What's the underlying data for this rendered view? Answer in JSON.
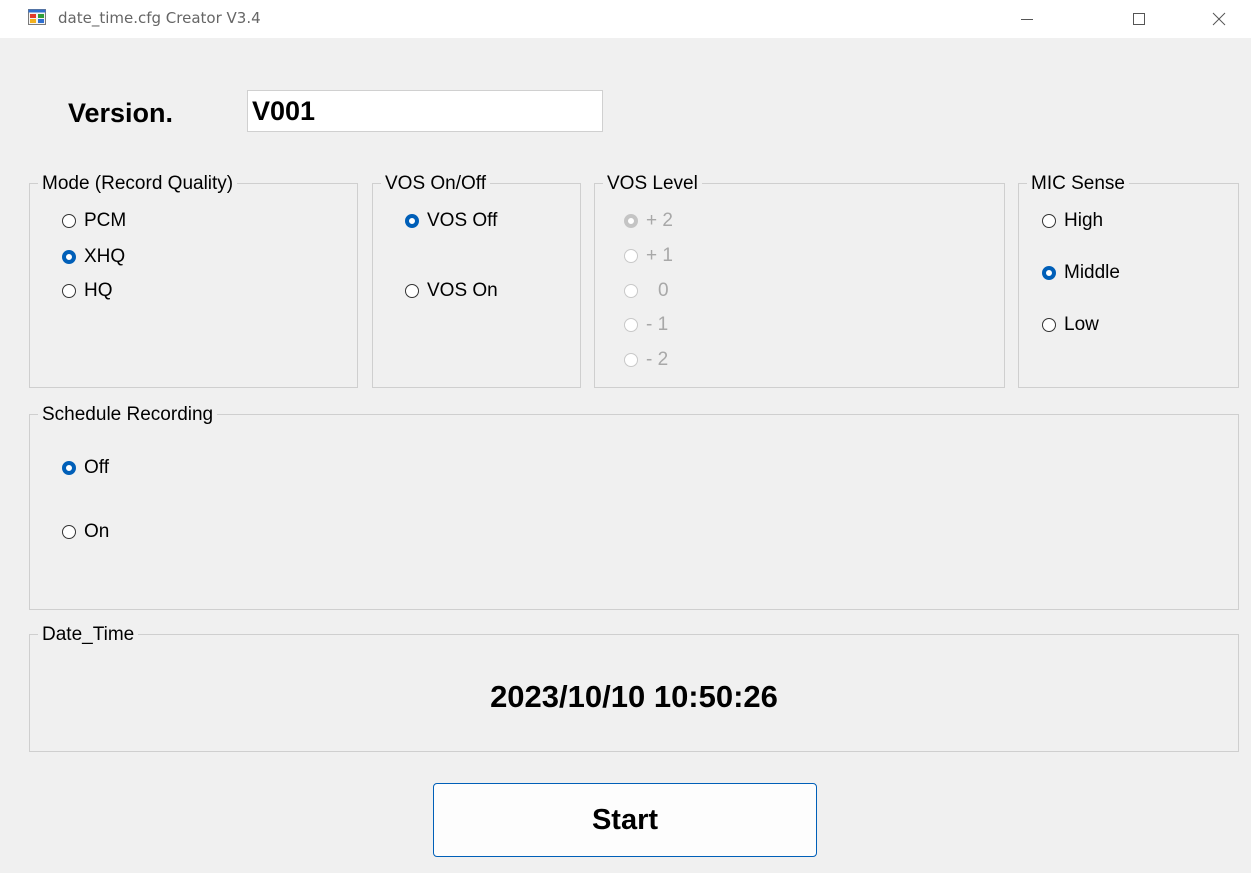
{
  "window": {
    "title": "date_time.cfg Creator V3.4",
    "icons": {
      "app": "form-app-icon",
      "minimize": "minimize-icon",
      "maximize": "maximize-icon",
      "close": "close-icon"
    }
  },
  "version": {
    "label": "Version.",
    "value": "V001"
  },
  "mode_group": {
    "label": "Mode (Record Quality)",
    "options": [
      {
        "label": "PCM",
        "checked": false
      },
      {
        "label": "XHQ",
        "checked": true
      },
      {
        "label": "HQ",
        "checked": false
      }
    ]
  },
  "vos_onoff_group": {
    "label": "VOS On/Off",
    "options": [
      {
        "label": "VOS Off",
        "checked": true
      },
      {
        "label": "VOS On",
        "checked": false
      }
    ]
  },
  "vos_level_group": {
    "label": "VOS Level",
    "enabled": false,
    "options": [
      {
        "label": "+ 2",
        "checked": true
      },
      {
        "label": "+ 1",
        "checked": false
      },
      {
        "label": "0",
        "checked": false
      },
      {
        "label": "- 1",
        "checked": false
      },
      {
        "label": "- 2",
        "checked": false
      }
    ]
  },
  "mic_sense_group": {
    "label": "MIC Sense",
    "options": [
      {
        "label": "High",
        "checked": false
      },
      {
        "label": "Middle",
        "checked": true
      },
      {
        "label": "Low",
        "checked": false
      }
    ]
  },
  "schedule_group": {
    "label": "Schedule Recording",
    "options": [
      {
        "label": "Off",
        "checked": true
      },
      {
        "label": "On",
        "checked": false
      }
    ]
  },
  "datetime_group": {
    "label": "Date_Time",
    "value": "2023/10/10 10:50:26"
  },
  "start_button": {
    "label": "Start"
  },
  "colors": {
    "accent": "#005fb8",
    "background": "#f0f0f0",
    "disabled_text": "#a8a8a8"
  }
}
